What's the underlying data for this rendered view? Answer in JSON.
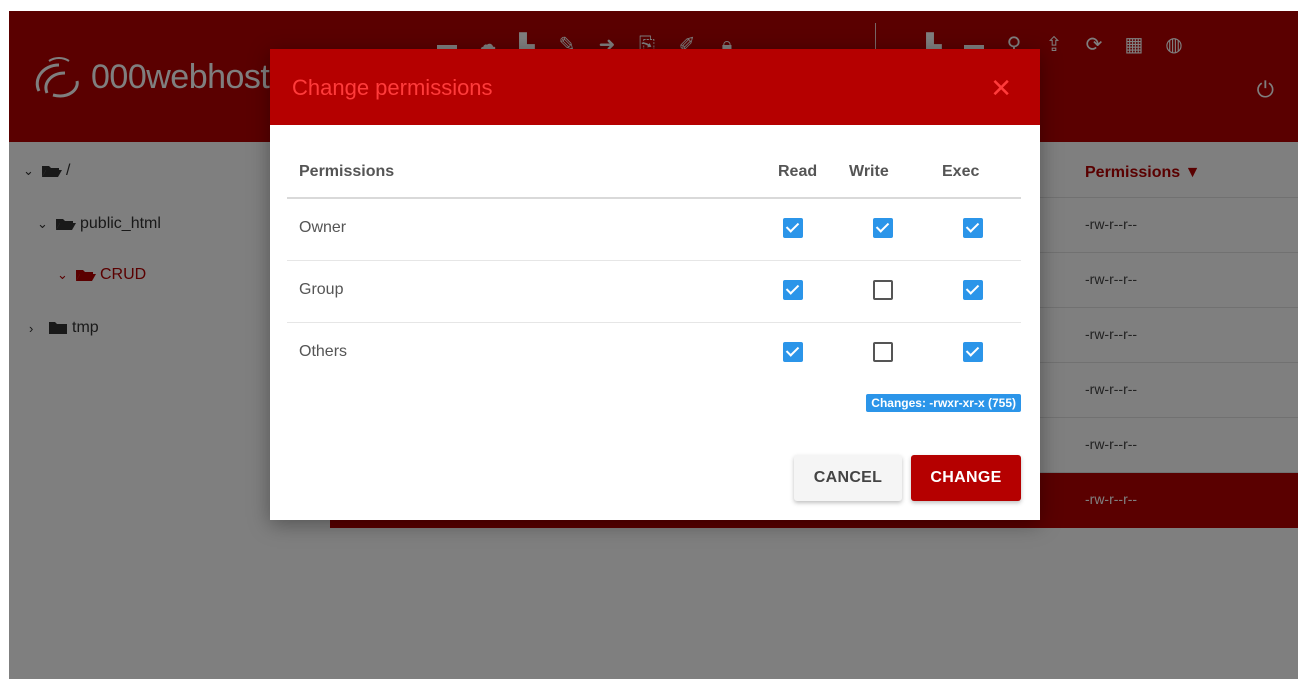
{
  "app": {
    "brand": "000webhost",
    "toolbar_icons": [
      "new-folder-icon",
      "upload-cloud-icon",
      "new-file-icon",
      "rename-icon",
      "move-icon",
      "copy-icon",
      "edit-icon",
      "lock-icon"
    ],
    "toolbar_right_icons": [
      "file-icon",
      "folder-icon",
      "search-icon",
      "upload-icon",
      "refresh-icon",
      "grid-icon",
      "globe-icon"
    ],
    "power_icon": "power-icon"
  },
  "sidebar": {
    "items": [
      {
        "label": "/",
        "expanded": true,
        "active": false
      },
      {
        "label": "public_html",
        "expanded": true,
        "active": false
      },
      {
        "label": "CRUD",
        "expanded": true,
        "active": true
      },
      {
        "label": "tmp",
        "expanded": false,
        "active": false
      }
    ]
  },
  "file_table": {
    "permissions_header": "Permissions ▼",
    "rows": [
      {
        "permissions": "-rw-r--r--",
        "selected": false
      },
      {
        "permissions": "-rw-r--r--",
        "selected": false
      },
      {
        "permissions": "-rw-r--r--",
        "selected": false
      },
      {
        "permissions": "-rw-r--r--",
        "selected": false
      },
      {
        "permissions": "-rw-r--r--",
        "selected": false
      },
      {
        "permissions": "-rw-r--r--",
        "selected": true
      }
    ]
  },
  "dialog": {
    "title": "Change permissions",
    "close_symbol": "✕",
    "columns": {
      "permissions": "Permissions",
      "read": "Read",
      "write": "Write",
      "exec": "Exec"
    },
    "rows": [
      {
        "label": "Owner",
        "read": true,
        "write": true,
        "exec": true
      },
      {
        "label": "Group",
        "read": true,
        "write": false,
        "exec": true
      },
      {
        "label": "Others",
        "read": true,
        "write": false,
        "exec": true
      }
    ],
    "changes_label": "Changes: -rwxr-xr-x (755)",
    "cancel_label": "CANCEL",
    "change_label": "CHANGE"
  },
  "colors": {
    "brand_red": "#b50000",
    "title_red": "#ff3b3b",
    "checkbox_blue": "#2b95e9"
  }
}
